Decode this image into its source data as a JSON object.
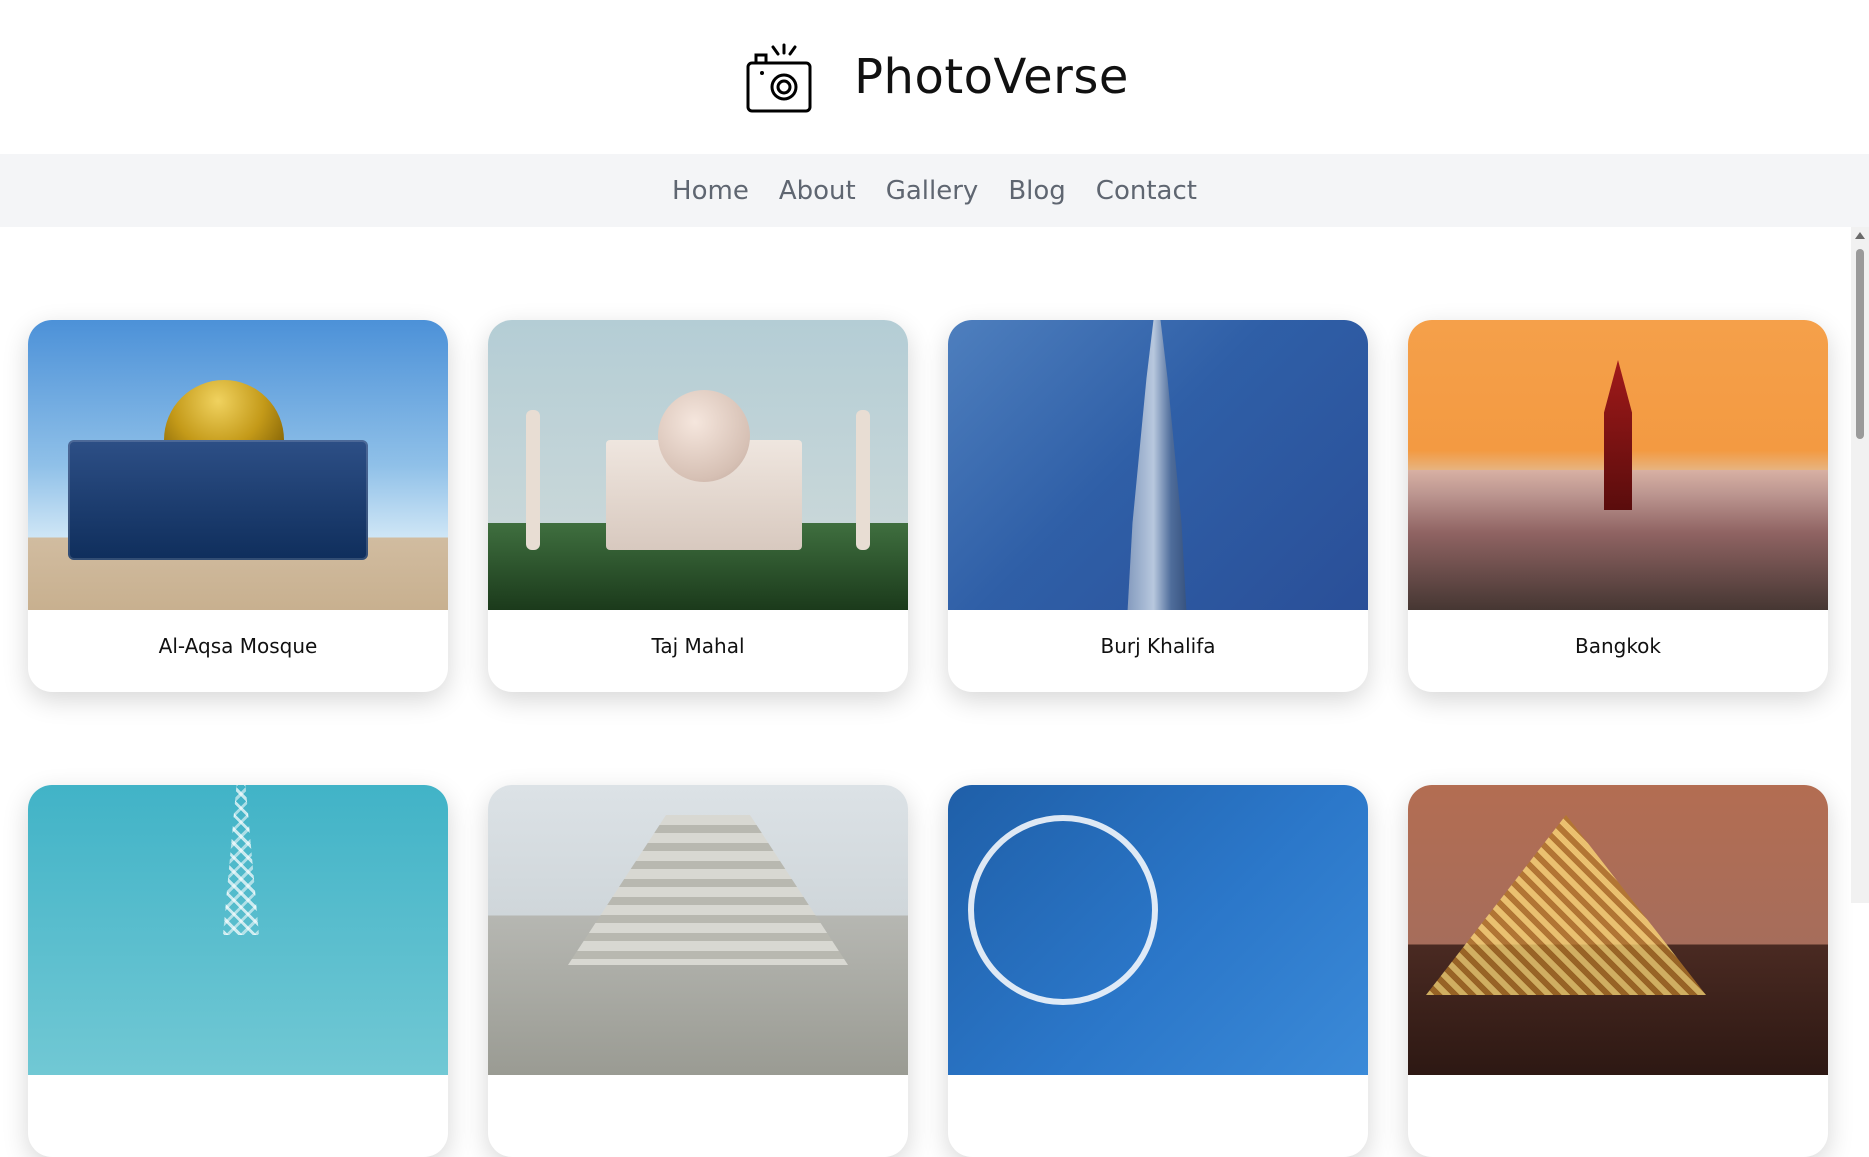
{
  "brand": {
    "title": "PhotoVerse",
    "logo_icon": "camera-icon"
  },
  "nav": {
    "items": [
      "Home",
      "About",
      "Gallery",
      "Blog",
      "Contact"
    ]
  },
  "gallery": {
    "cards": [
      {
        "caption": "Al-Aqsa Mosque",
        "image": "al-aqsa-mosque-photo"
      },
      {
        "caption": "Taj Mahal",
        "image": "taj-mahal-photo"
      },
      {
        "caption": "Burj Khalifa",
        "image": "burj-khalifa-photo"
      },
      {
        "caption": "Bangkok",
        "image": "bangkok-photo"
      },
      {
        "caption": "",
        "image": "eiffel-tower-photo"
      },
      {
        "caption": "",
        "image": "chichen-itza-photo"
      },
      {
        "caption": "",
        "image": "london-eye-photo"
      },
      {
        "caption": "",
        "image": "louvre-pyramid-photo"
      }
    ]
  },
  "colors": {
    "nav_background": "#f4f5f7",
    "nav_text": "#5f6671",
    "page_background": "#ffffff"
  }
}
